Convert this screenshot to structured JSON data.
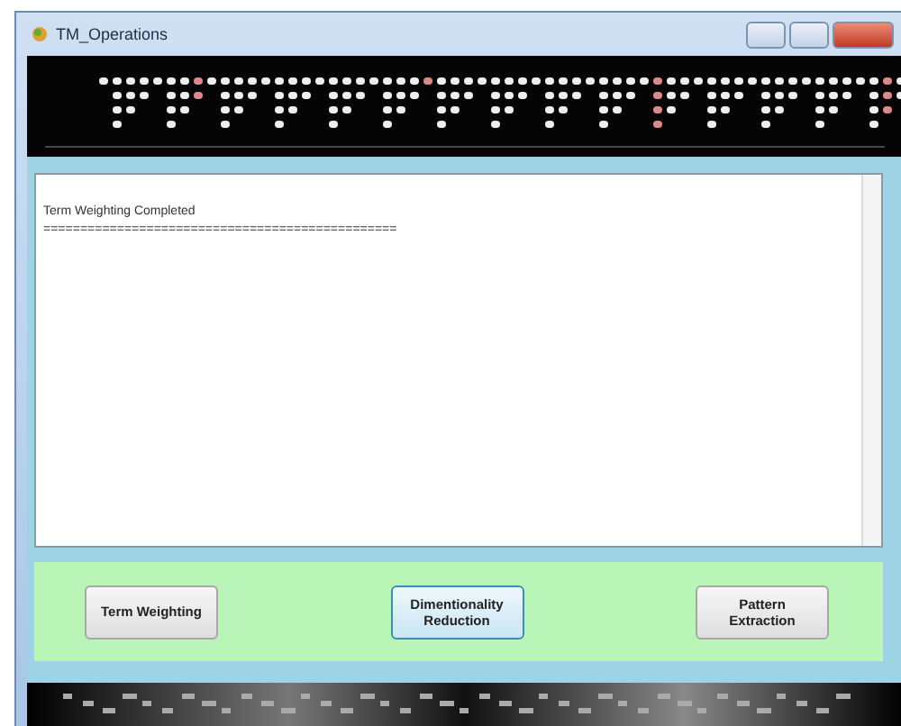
{
  "window": {
    "title": "TM_Operations"
  },
  "output": {
    "lines": [
      "Term Weighting Completed",
      "================================================"
    ]
  },
  "buttons": [
    {
      "label": "Term Weighting",
      "selected": false
    },
    {
      "label": "Dimentionality Reduction",
      "selected": true
    },
    {
      "label": "Pattern Extraction",
      "selected": false
    }
  ]
}
